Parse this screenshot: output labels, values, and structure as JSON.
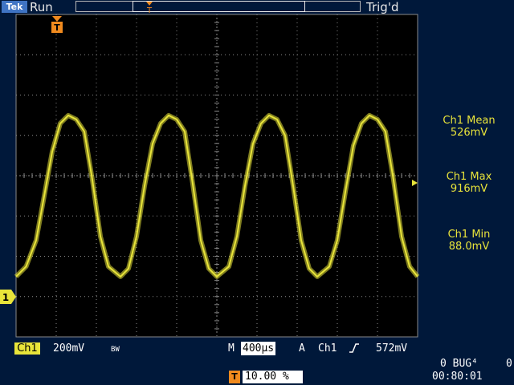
{
  "header": {
    "brand": "Tek",
    "acquisition_state": "Run",
    "trigger_status": "Trig'd"
  },
  "markers": {
    "trigger_position_icon": "T",
    "channel1_ground_label": "1"
  },
  "measurements": [
    {
      "label": "Ch1 Mean",
      "value": "526mV"
    },
    {
      "label": "Ch1 Max",
      "value": "916mV"
    },
    {
      "label": "Ch1 Min",
      "value": "88.0mV"
    }
  ],
  "status_bar": {
    "channel_badge": "Ch1",
    "vertical_scale": "200mV",
    "bandwidth_limit": "BW",
    "timebase_prefix": "M",
    "timebase_value": "400µs",
    "trigger_mode_prefix": "A",
    "trigger_source": "Ch1",
    "trigger_slope_icon": "rising-edge-icon",
    "trigger_level": "572mV",
    "trigger_position_percent": "10.00 %",
    "counter_label": "0 BUG⁴",
    "counter_right": "0",
    "clock": "00:80:01"
  },
  "colors": {
    "screen_background": "#00183a",
    "plot_background": "#000000",
    "trace": "#e8e43a",
    "graticule": "#8a8a8a",
    "trigger_marker": "#f08a1e",
    "brand_badge": "#3f74c4"
  },
  "chart_data": {
    "type": "line",
    "x_unit": "divisions",
    "y_unit": "V",
    "x_divisions": 10,
    "y_divisions": 8,
    "volts_per_division": 0.2,
    "time_per_division_us": 400,
    "series": [
      {
        "name": "Ch1",
        "color": "#e8e43a",
        "x": [
          0.0,
          0.25,
          0.5,
          0.7,
          0.9,
          1.1,
          1.3,
          1.5,
          1.7,
          1.9,
          2.1,
          2.3,
          2.6,
          2.8,
          3.0,
          3.2,
          3.4,
          3.6,
          3.8,
          4.0,
          4.2,
          4.4,
          4.6,
          4.8,
          5.0,
          5.3,
          5.5,
          5.7,
          5.9,
          6.1,
          6.3,
          6.5,
          6.7,
          6.9,
          7.1,
          7.3,
          7.5,
          7.8,
          8.0,
          8.2,
          8.4,
          8.6,
          8.8,
          9.0,
          9.2,
          9.4,
          9.6,
          9.8,
          10.0
        ],
        "y": [
          0.1,
          0.15,
          0.28,
          0.5,
          0.72,
          0.86,
          0.9,
          0.88,
          0.82,
          0.58,
          0.3,
          0.15,
          0.1,
          0.14,
          0.3,
          0.55,
          0.76,
          0.86,
          0.9,
          0.88,
          0.82,
          0.56,
          0.28,
          0.14,
          0.1,
          0.15,
          0.3,
          0.55,
          0.76,
          0.86,
          0.9,
          0.88,
          0.8,
          0.55,
          0.28,
          0.14,
          0.1,
          0.15,
          0.28,
          0.52,
          0.75,
          0.86,
          0.9,
          0.88,
          0.82,
          0.58,
          0.3,
          0.15,
          0.1
        ]
      }
    ],
    "trigger_level_v": 0.572
  }
}
